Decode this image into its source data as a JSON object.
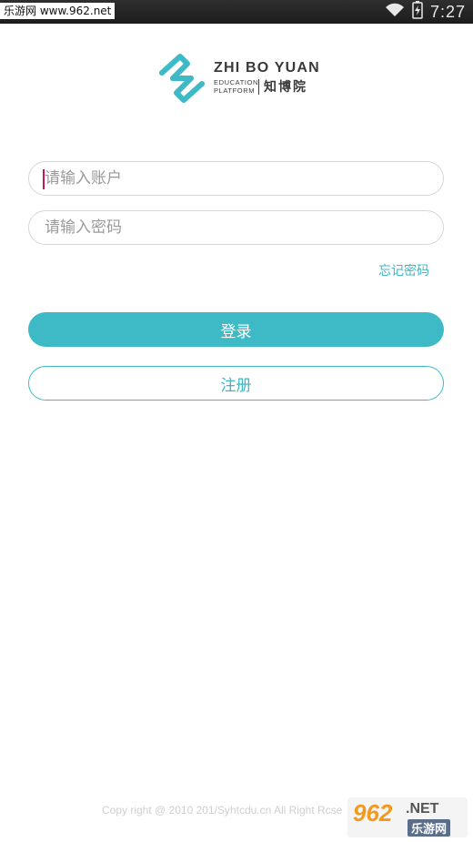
{
  "status_bar": {
    "watermark": "乐游网 www.962.net",
    "time": "7:27",
    "icons": [
      "wifi-icon",
      "battery-charging-icon"
    ]
  },
  "logo": {
    "brand_name": "ZHI BO YUAN",
    "sub_line1": "EDUCATION",
    "sub_line2": "PLATFORM",
    "brand_cn": "知博院",
    "accent_color": "#3dbac6"
  },
  "form": {
    "account_placeholder": "请输入账户",
    "password_placeholder": "请输入密码",
    "forgot_password": "忘记密码",
    "login_label": "登录",
    "register_label": "注册"
  },
  "footer": {
    "copyright": "Copy right @ 2010 201/Syhtcdu.cn All Right Rcse"
  },
  "watermark_bottom": {
    "number": "962",
    "net": ".NET",
    "cn": "乐游网"
  }
}
